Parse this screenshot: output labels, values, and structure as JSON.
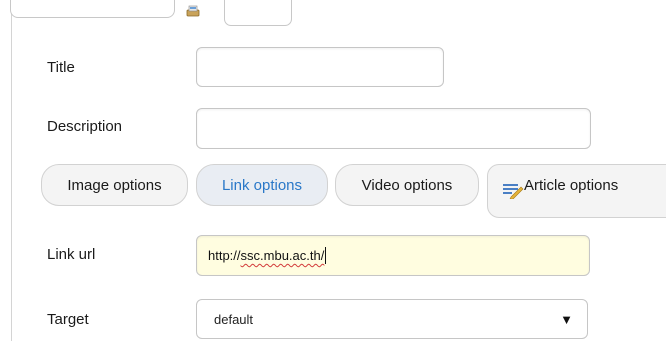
{
  "form": {
    "title_label": "Title",
    "title_value": "",
    "description_label": "Description",
    "description_value": "",
    "link_url_label": "Link url",
    "link_url_value": "http://ssc.mbu.ac.th/",
    "link_url_prefix": "http://",
    "link_url_typo": "ssc.mbu.ac.th/",
    "target_label": "Target",
    "target_value": "default"
  },
  "tabs": [
    {
      "label": "Image options",
      "active": false
    },
    {
      "label": "Link options",
      "active": true
    },
    {
      "label": "Video options",
      "active": false
    },
    {
      "label": "Article options",
      "active": false,
      "icon": "article-pencil-icon"
    }
  ],
  "icons": {
    "top_icon": "image-picker-icon",
    "select_arrow": "▼"
  },
  "colors": {
    "active_tab_text": "#2a78c8",
    "link_input_bg": "#fffde0",
    "spellcheck": "#d23a3a"
  }
}
